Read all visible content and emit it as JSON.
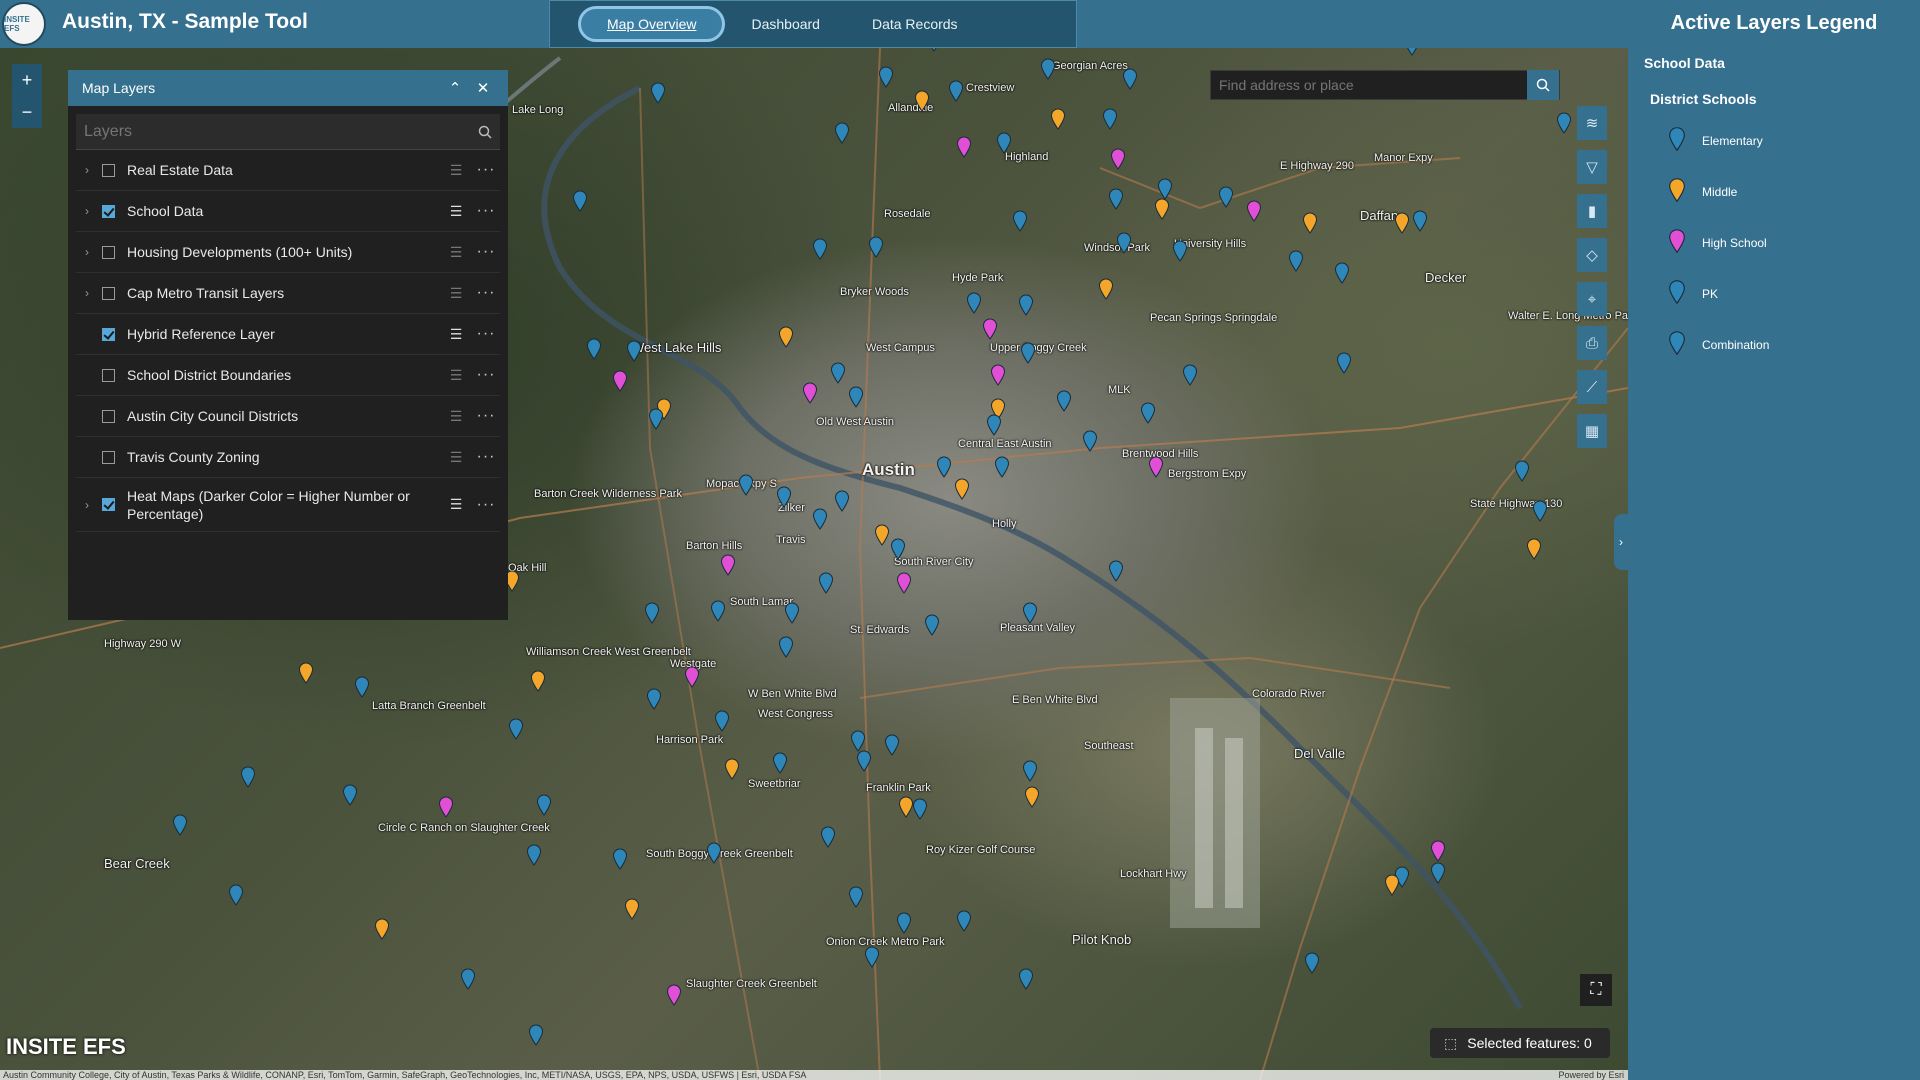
{
  "header": {
    "logo_text": "INSITE EFS",
    "title": "Austin, TX - Sample Tool",
    "tabs": [
      "Map Overview",
      "Dashboard",
      "Data Records"
    ]
  },
  "panel": {
    "title": "Map Layers",
    "search_placeholder": "Layers",
    "layers": [
      {
        "name": "Real Estate Data",
        "checked": false,
        "expandable": true
      },
      {
        "name": "School Data",
        "checked": true,
        "expandable": true
      },
      {
        "name": "Housing Developments (100+ Units)",
        "checked": false,
        "expandable": true
      },
      {
        "name": "Cap Metro Transit Layers",
        "checked": false,
        "expandable": true
      },
      {
        "name": "Hybrid Reference Layer",
        "checked": true,
        "expandable": false
      },
      {
        "name": "School District Boundaries",
        "checked": false,
        "expandable": false
      },
      {
        "name": "Austin City Council Districts",
        "checked": false,
        "expandable": false
      },
      {
        "name": "Travis County Zoning",
        "checked": false,
        "expandable": false
      },
      {
        "name": "Heat Maps (Darker Color = Higher Number or Percentage)",
        "checked": true,
        "expandable": true
      }
    ]
  },
  "search": {
    "placeholder": "Find address or place"
  },
  "selected_features": "Selected features: 0",
  "bottom_logo": "INSITE EFS",
  "attribution": "Austin Community College, City of Austin, Texas Parks & Wildlife, CONANP, Esri, TomTom, Garmin, SafeGraph, GeoTechnologies, Inc, METI/NASA, USGS, EPA, NPS, USDA, USFWS | Esri, USDA FSA",
  "powered_by": "Powered by Esri",
  "legend": {
    "title": "Active Layers Legend",
    "group": "School Data",
    "subgroup": "District Schools",
    "items": [
      {
        "label": "Elementary",
        "color": "#2f86b8"
      },
      {
        "label": "Middle",
        "color": "#f3a62a"
      },
      {
        "label": "High School",
        "color": "#e04fd6"
      },
      {
        "label": "PK",
        "color": "#2f86b8"
      },
      {
        "label": "Combination",
        "color": "#2f86b8"
      }
    ]
  },
  "map_labels": [
    {
      "text": "Austin",
      "size": "big"
    },
    {
      "text": "West Lake Hills",
      "size": "mid"
    },
    {
      "text": "Daffan",
      "size": "mid"
    },
    {
      "text": "Decker",
      "size": "mid"
    },
    {
      "text": "Del Valle",
      "size": "mid"
    },
    {
      "text": "Pilot Knob",
      "size": "mid"
    },
    {
      "text": "Bear Creek",
      "size": "mid"
    },
    {
      "text": "Highland",
      "size": ""
    },
    {
      "text": "Rosedale",
      "size": ""
    },
    {
      "text": "Crestview",
      "size": ""
    },
    {
      "text": "Georgian Acres",
      "size": ""
    },
    {
      "text": "Hyde Park",
      "size": ""
    },
    {
      "text": "Bryker Woods",
      "size": ""
    },
    {
      "text": "West Campus",
      "size": ""
    },
    {
      "text": "MLK",
      "size": ""
    },
    {
      "text": "Zilker",
      "size": ""
    },
    {
      "text": "Barton Hills",
      "size": ""
    },
    {
      "text": "South Lamar",
      "size": ""
    },
    {
      "text": "Westgate",
      "size": ""
    },
    {
      "text": "West Congress",
      "size": ""
    },
    {
      "text": "Southeast",
      "size": ""
    },
    {
      "text": "Pleasant Valley",
      "size": ""
    },
    {
      "text": "Holly",
      "size": ""
    },
    {
      "text": "Roy Kizer Golf Course",
      "size": ""
    },
    {
      "text": "Onion Creek Metro Park",
      "size": ""
    },
    {
      "text": "Slaughter Creek Greenbelt",
      "size": ""
    },
    {
      "text": "South Boggy Creek Greenbelt",
      "size": ""
    },
    {
      "text": "Latta Branch Greenbelt",
      "size": ""
    },
    {
      "text": "Williamson Creek West Greenbelt",
      "size": ""
    },
    {
      "text": "Barton Creek Wilderness Park",
      "size": ""
    },
    {
      "text": "Pecan Springs Springdale",
      "size": ""
    },
    {
      "text": "University Hills",
      "size": ""
    },
    {
      "text": "Windsor Park",
      "size": ""
    },
    {
      "text": "Walter E. Long Metro Park",
      "size": ""
    },
    {
      "text": "E Ben White Blvd",
      "size": ""
    },
    {
      "text": "Mopac Expy S",
      "size": ""
    },
    {
      "text": "Highway 290 W",
      "size": ""
    },
    {
      "text": "E Highway 290",
      "size": ""
    },
    {
      "text": "Manor Expy",
      "size": ""
    },
    {
      "text": "State Highway 130",
      "size": ""
    },
    {
      "text": "Lockhart Hwy",
      "size": ""
    },
    {
      "text": "Colorado River",
      "size": ""
    },
    {
      "text": "Bergstrom Expy",
      "size": ""
    },
    {
      "text": "Oak Hill",
      "size": ""
    },
    {
      "text": "South River City",
      "size": ""
    },
    {
      "text": "Travis",
      "size": ""
    },
    {
      "text": "Old West Austin",
      "size": ""
    },
    {
      "text": "Central East Austin",
      "size": ""
    },
    {
      "text": "Upper Boggy Creek",
      "size": ""
    },
    {
      "text": "Circle C Ranch on Slaughter Creek",
      "size": ""
    },
    {
      "text": "St. Edwards",
      "size": ""
    },
    {
      "text": "Sweetbriar",
      "size": ""
    },
    {
      "text": "Franklin Park",
      "size": ""
    },
    {
      "text": "Harrison Park",
      "size": ""
    },
    {
      "text": "W Ben White Blvd",
      "size": ""
    },
    {
      "text": "Brentwood Hills",
      "size": ""
    },
    {
      "text": "Lake Long",
      "size": ""
    },
    {
      "text": "Allandale",
      "size": ""
    }
  ],
  "pin_colors": {
    "blue": "#2f86b8",
    "orange": "#f3a62a",
    "pink": "#e04fd6"
  }
}
